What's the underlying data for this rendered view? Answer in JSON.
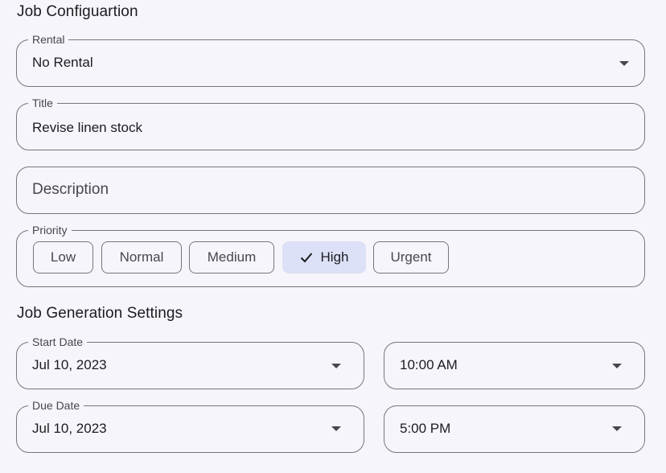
{
  "job_config": {
    "heading": "Job Configuartion",
    "rental": {
      "label": "Rental",
      "value": "No Rental",
      "icon": "dropdown-arrow-icon"
    },
    "title": {
      "label": "Title",
      "value": "Revise linen stock"
    },
    "description": {
      "placeholder": "Description"
    },
    "priority": {
      "label": "Priority",
      "options": [
        "Low",
        "Normal",
        "Medium",
        "High",
        "Urgent"
      ],
      "selected": "High",
      "selected_icon": "check-icon"
    }
  },
  "generation": {
    "heading": "Job Generation Settings",
    "start_date": {
      "label": "Start Date",
      "value": "Jul 10, 2023",
      "icon": "dropdown-arrow-icon"
    },
    "start_time": {
      "value": "10:00 AM",
      "icon": "dropdown-arrow-icon"
    },
    "due_date": {
      "label": "Due Date",
      "value": "Jul 10, 2023",
      "icon": "dropdown-arrow-icon"
    },
    "due_time": {
      "value": "5:00 PM",
      "icon": "dropdown-arrow-icon"
    }
  },
  "colors": {
    "background": "#f6f5fb",
    "outline": "#79747e",
    "selected_chip": "#dce1f7",
    "text": "#1d1b20",
    "muted_text": "#49454f"
  }
}
